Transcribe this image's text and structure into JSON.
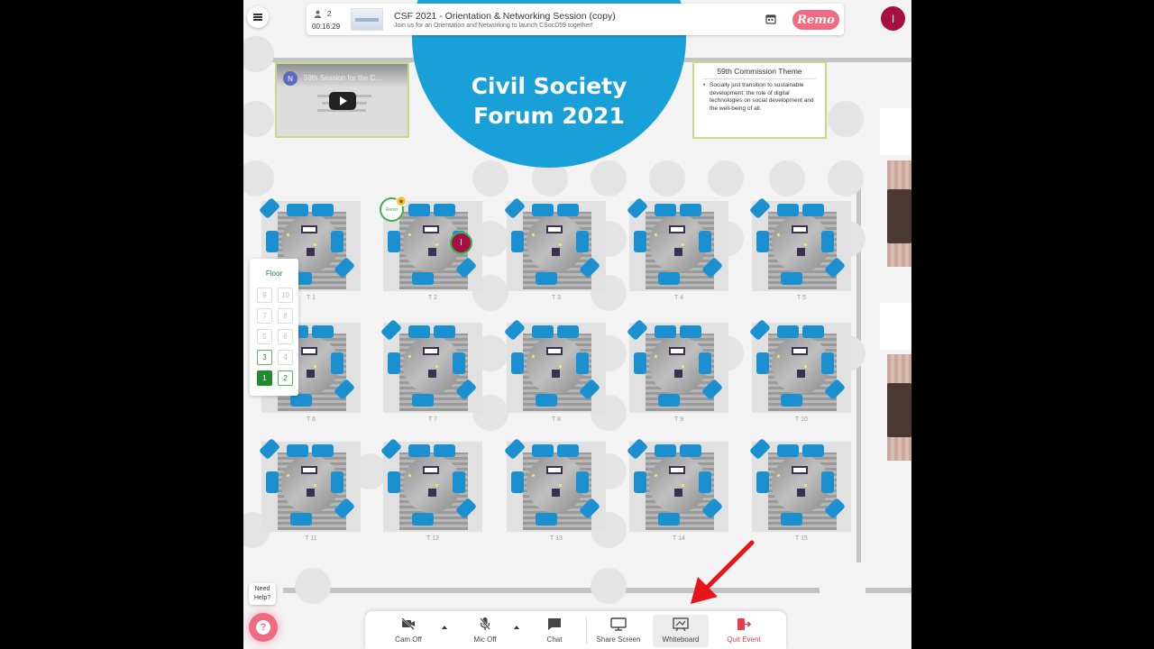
{
  "header": {
    "attendee_count": "2",
    "timer": "00:16:29",
    "event_title": "CSF 2021 - Orientation & Networking Session (copy)",
    "event_subtitle": "Join us for an Orientation and Networking to launch CSocD59 together!",
    "brand": "Remo",
    "user_initial": "I"
  },
  "stage": {
    "banner_line1": "Civil Society",
    "banner_line2": "Forum 2021",
    "video": {
      "channel_initial": "N",
      "title": "59th Session for the C..."
    },
    "theme": {
      "title": "59th Commission Theme",
      "text": "Socially just transition to sustainable development: the role of digital technologies on social development and the well-being of all."
    }
  },
  "tables": [
    {
      "label": "T 1"
    },
    {
      "label": "T 2"
    },
    {
      "label": "T 3"
    },
    {
      "label": "T 4"
    },
    {
      "label": "T 5"
    },
    {
      "label": "T 6"
    },
    {
      "label": "T 7"
    },
    {
      "label": "T 8"
    },
    {
      "label": "T 9"
    },
    {
      "label": "T 10"
    },
    {
      "label": "T 11"
    },
    {
      "label": "T 12"
    },
    {
      "label": "T 13"
    },
    {
      "label": "T 14"
    },
    {
      "label": "T 15"
    }
  ],
  "presence": {
    "host_badge": "Remo",
    "guest_initial": "I"
  },
  "floor_selector": {
    "title": "Floor",
    "floors": [
      "9",
      "10",
      "7",
      "8",
      "5",
      "6",
      "3",
      "4",
      "1",
      "2"
    ],
    "available": [
      "1",
      "2",
      "3"
    ],
    "current": "1"
  },
  "help": {
    "label_line1": "Need",
    "label_line2": "Help?"
  },
  "toolbar": {
    "cam": "Cam Off",
    "mic": "Mic Off",
    "chat": "Chat",
    "share": "Share Screen",
    "whiteboard": "Whiteboard",
    "quit": "Quit Event"
  },
  "colors": {
    "brand_pink": "#ef6b82",
    "chair_blue": "#1a90d1",
    "stage_blue": "#1aa0d8",
    "user_maroon": "#a50f42",
    "floor_green": "#1f8a2e",
    "quit_red": "#e53d4a",
    "annotation_arrow": "#e8141c"
  }
}
